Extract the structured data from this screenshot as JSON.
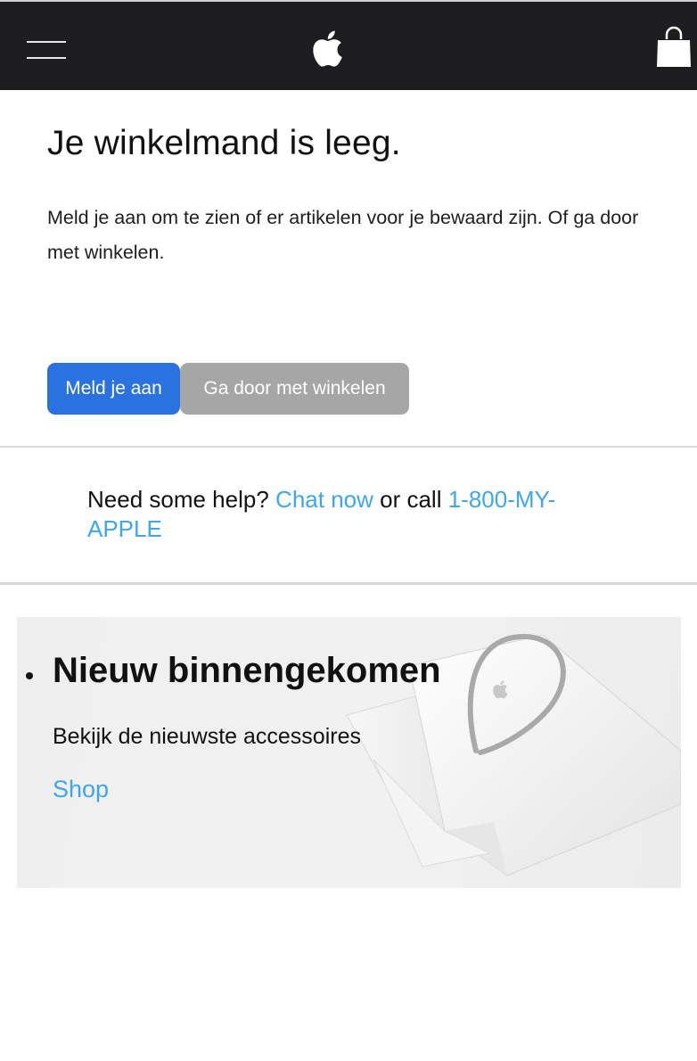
{
  "header": {
    "menu_icon": "hamburger-menu-icon",
    "logo_icon": "apple-logo-icon",
    "bag_icon": "shopping-bag-icon",
    "background": "#1d1d1f"
  },
  "cart": {
    "title": "Je winkelmand is leeg.",
    "description": "Meld je aan om te zien of er artikelen voor je bewaard zijn. Of ga door met winkelen.",
    "sign_in_label": "Meld je aan",
    "continue_label": "Ga door met winkelen"
  },
  "help": {
    "prefix": "Need some help?",
    "chat_label": "Chat now",
    "middle": "or call",
    "phone_label": "1-800-MY-APPLE"
  },
  "promo": {
    "title": "Nieuw binnengekomen",
    "subtitle": "Bekijk de nieuwste accessoires",
    "link_label": "Shop",
    "image_icon": "shopping-bag-image"
  },
  "colors": {
    "primary_button": "#2a72e0",
    "secondary_button": "#a6a6a6",
    "link": "#3ea6ee"
  }
}
